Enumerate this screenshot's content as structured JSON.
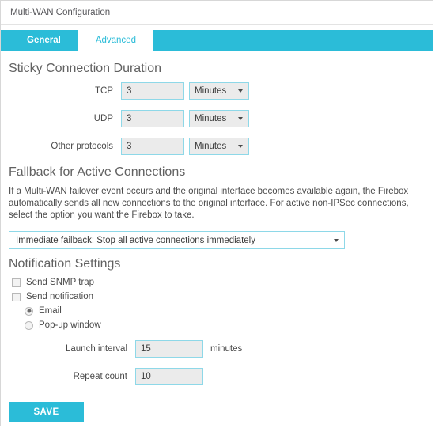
{
  "window": {
    "title": "Multi-WAN Configuration"
  },
  "theme": {
    "accent": "#2bbcd8",
    "field_border": "#8ed8e8",
    "field_fill": "#ebebeb",
    "heading_color": "#616161",
    "text_color": "#4a4a4a"
  },
  "tabs": [
    {
      "label": "General",
      "active": false
    },
    {
      "label": "Advanced",
      "active": true
    }
  ],
  "sticky_connection_duration": {
    "heading": "Sticky Connection Duration",
    "rows": [
      {
        "label": "TCP",
        "value": "3",
        "unit": "Minutes"
      },
      {
        "label": "UDP",
        "value": "3",
        "unit": "Minutes"
      },
      {
        "label": "Other protocols",
        "value": "3",
        "unit": "Minutes"
      }
    ]
  },
  "fallback": {
    "heading": "Fallback for Active Connections",
    "description": "If a Multi-WAN failover event occurs and the original interface becomes available again, the Firebox automatically sends all new connections to the original interface. For active non-IPSec connections, select the option you want the Firebox to take.",
    "selected": "Immediate failback: Stop all active connections immediately"
  },
  "notifications": {
    "heading": "Notification Settings",
    "send_snmp_trap": {
      "label": "Send SNMP trap",
      "checked": false
    },
    "send_notification": {
      "label": "Send notification",
      "checked": false
    },
    "method_email": {
      "label": "Email",
      "selected": true
    },
    "method_popup": {
      "label": "Pop-up window",
      "selected": false
    },
    "launch_interval": {
      "label": "Launch interval",
      "value": "15",
      "unit": "minutes"
    },
    "repeat_count": {
      "label": "Repeat count",
      "value": "10"
    }
  },
  "footer": {
    "save_label": "SAVE"
  }
}
